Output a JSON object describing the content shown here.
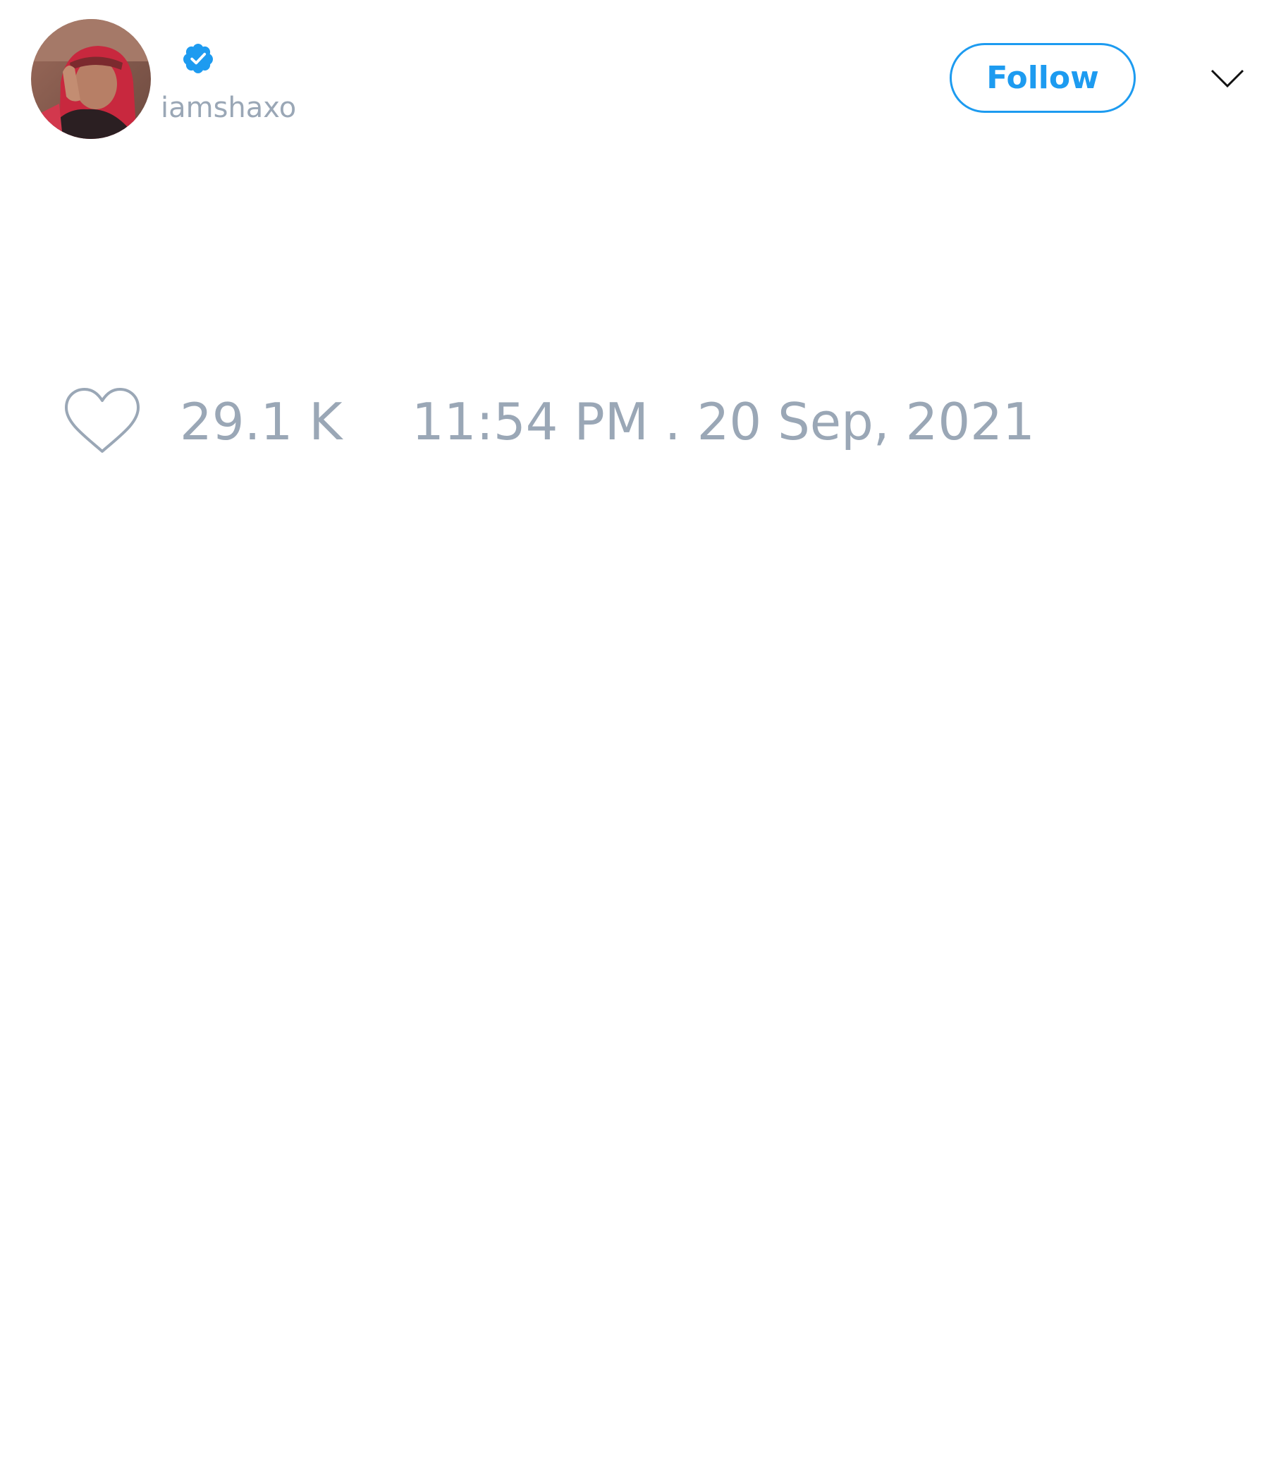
{
  "tweet": {
    "author": {
      "handle": "iamshaxo",
      "verified": true,
      "verified_color": "#1d9bf0"
    },
    "follow_button": {
      "label": "Follow",
      "color": "#1d9bf0"
    },
    "menu_icon": "chevron-down-icon",
    "stats": {
      "like_icon": "heart-icon",
      "likes": "29.1 K",
      "timestamp": "11:54 PM . 20 Sep, 2021",
      "text_color": "#9aa7b6"
    }
  }
}
